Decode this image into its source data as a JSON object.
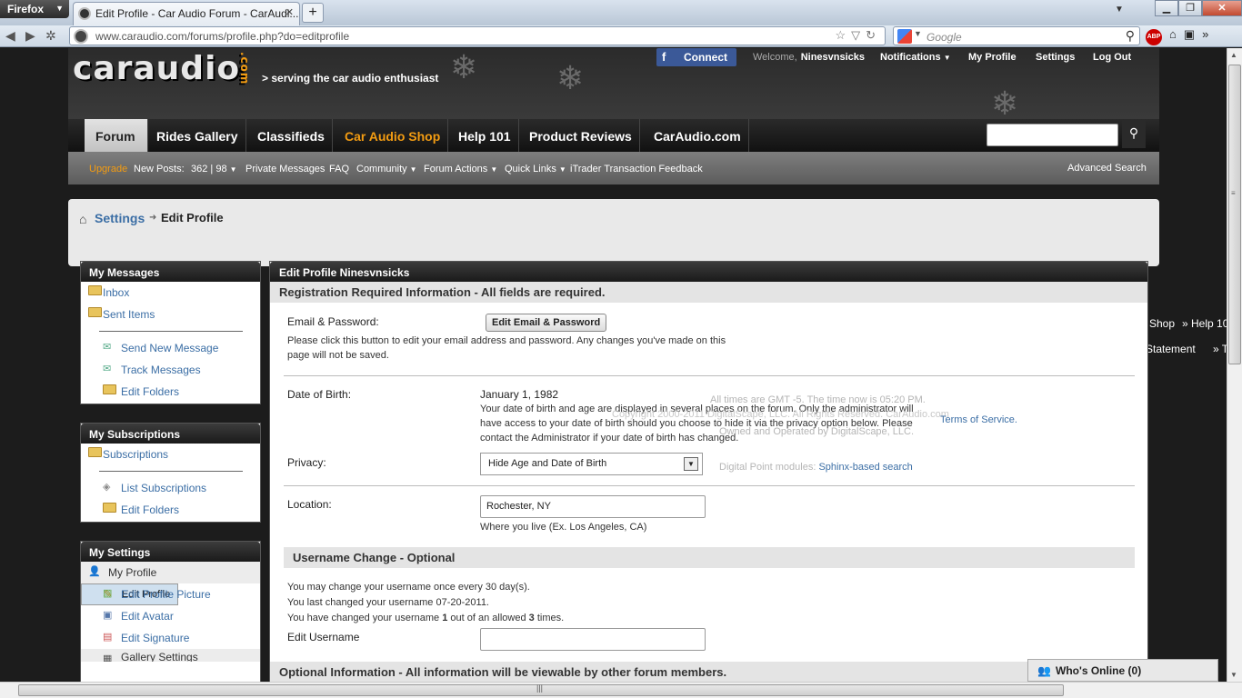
{
  "browser": {
    "firefox_label": "Firefox",
    "tab_title": "Edit Profile - Car Audio Forum - CarAudi...",
    "new_tab": "+",
    "url": "www.caraudio.com/forums/profile.php?do=editprofile",
    "search_placeholder": "Google"
  },
  "header": {
    "logo": "caraudio",
    "logo_suffix": ".com",
    "tagline": "> serving the car audio enthusiast",
    "facebook_connect": "Connect",
    "welcome": "Welcome,",
    "username": "Ninesvnsicks",
    "notifications": "Notifications",
    "my_profile": "My Profile",
    "settings": "Settings",
    "logout": "Log Out"
  },
  "main_nav": [
    {
      "label": "Forum",
      "active": true
    },
    {
      "label": "Rides Gallery"
    },
    {
      "label": "Classifieds"
    },
    {
      "label": "Car Audio Shop",
      "accent": "#f39c12"
    },
    {
      "label": "Help 101"
    },
    {
      "label": "Product Reviews"
    },
    {
      "label": "CarAudio.com"
    }
  ],
  "sub_nav": {
    "upgrade": "Upgrade",
    "new_posts": "New Posts:",
    "counts": "362 | 98",
    "private_messages": "Private Messages",
    "faq": "FAQ",
    "community": "Community",
    "forum_actions": "Forum Actions",
    "quick_links": "Quick Links",
    "itrader": "iTrader Transaction Feedback",
    "advanced_search": "Advanced Search"
  },
  "breadcrumb": {
    "settings": "Settings",
    "current": "Edit Profile"
  },
  "sidebar": {
    "messages": {
      "title": "My Messages",
      "items": [
        "Inbox",
        "Sent Items"
      ],
      "sub_items": [
        "Send New Message",
        "Track Messages",
        "Edit Folders"
      ]
    },
    "subscriptions": {
      "title": "My Subscriptions",
      "items": [
        "Subscriptions"
      ],
      "sub_items": [
        "List Subscriptions",
        "Edit Folders"
      ]
    },
    "settings": {
      "title": "My Settings",
      "category": "My Profile",
      "items": [
        "Edit Profile",
        "Edit Profile Picture",
        "Edit Avatar",
        "Edit Signature"
      ],
      "next": "Gallery Settings"
    }
  },
  "main": {
    "title": "Edit Profile Ninesvnsicks",
    "registration_header": "Registration Required Information - All fields are required.",
    "email_label": "Email & Password:",
    "email_button": "Edit Email & Password",
    "email_desc1": "Please click this button to edit your email address and password. Any changes you've made on this",
    "email_desc2": "page will not be saved.",
    "dob_label": "Date of Birth:",
    "dob_value": "January 1, 1982",
    "dob_desc1": "Your date of birth and age are displayed in several places on the forum. Only the administrator will",
    "dob_desc2": "have access to your date of birth should you choose to hide it via the privacy option below. Please",
    "dob_desc3": "contact the Administrator if your date of birth has changed.",
    "privacy_label": "Privacy:",
    "privacy_value": "Hide Age and Date of Birth",
    "location_label": "Location:",
    "location_value": "Rochester, NY",
    "location_desc": "Where you live (Ex. Los Angeles, CA)",
    "username_header": "Username Change - Optional",
    "username_desc1": "You may change your username once every 30 day(s).",
    "username_desc2": "You last changed your username 07-20-2011.",
    "username_desc3_a": "You have changed your username ",
    "username_desc3_b": "1",
    "username_desc3_c": " out of an allowed ",
    "username_desc3_d": "3",
    "username_desc3_e": " times.",
    "edit_username_label": "Edit Username",
    "optional_header": "Optional Information - All information will be viewable by other forum members."
  },
  "background_footer": {
    "time_text": "All times are GMT -5. The time now is ",
    "time_value": "05:20 PM",
    "terms": "Terms of Service",
    "copyright": "Copyright 2000-2011 DigitalScape, LLC. All Rights Reserved. CarAudio.com",
    "owned": "Owned and Operated by DigitalScape, LLC.",
    "dp_modules": "Digital Point modules:",
    "sphinx": "Sphinx-based search",
    "shop": "Shop",
    "help": "» Help 10",
    "statement": "Statement",
    "statement_sep": "» T"
  },
  "whos_online": "Who's Online (0)"
}
